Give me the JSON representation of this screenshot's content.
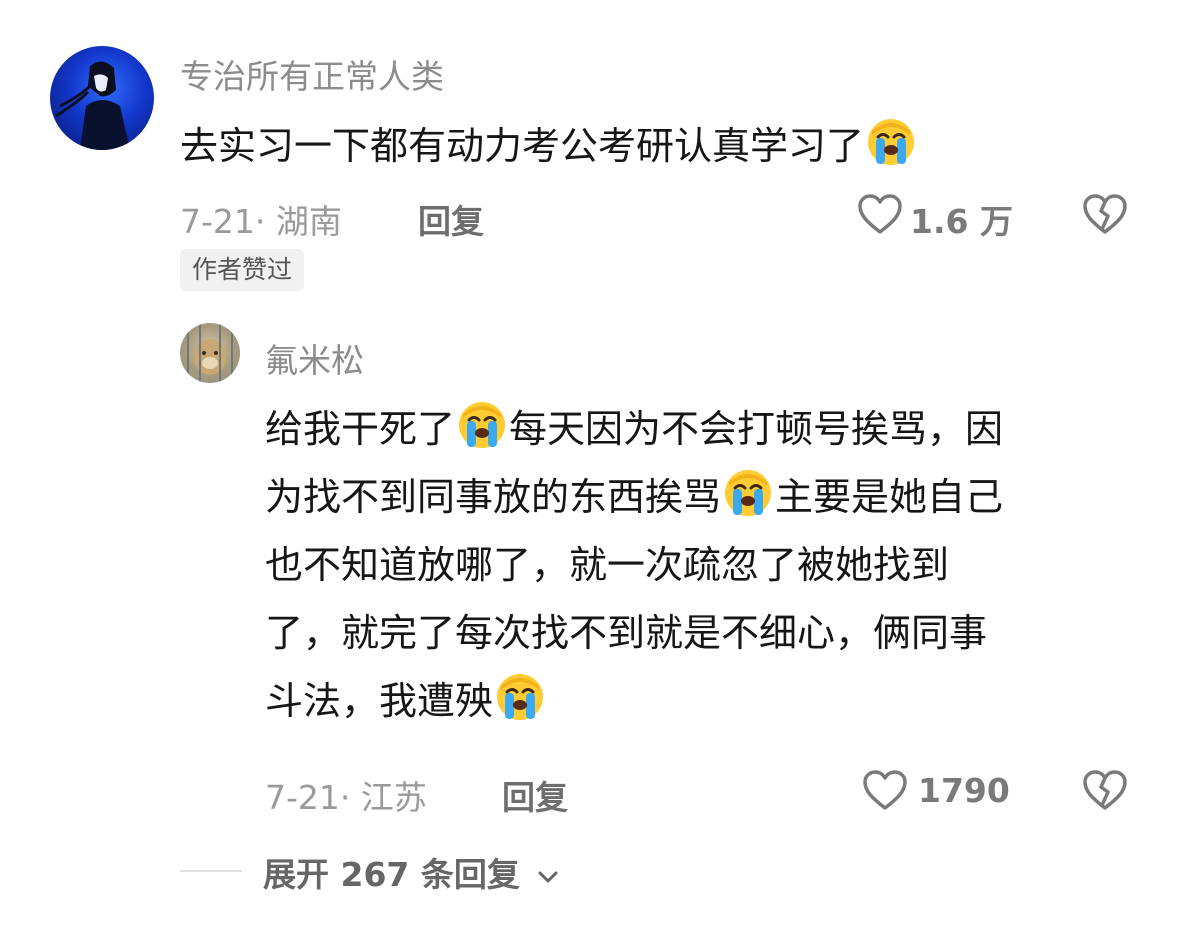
{
  "comments": [
    {
      "username": "专治所有正常人类",
      "text_parts": [
        "去实习一下都有动力考公考研认真学习了"
      ],
      "date_location": "7-21· 湖南",
      "reply_label": "回复",
      "like_count": "1.6 万",
      "badge": "作者赞过"
    },
    {
      "username": "氟米松",
      "lines": [
        [
          "给我干死了",
          "每天因为不会打顿号挨骂，因"
        ],
        [
          "为找不到同事放的东西挨骂",
          "主要是她自己"
        ],
        [
          "也不知道放哪了，就一次疏忽了被她找到"
        ],
        [
          "了，就完了每次找不到就是不细心，俩同事"
        ],
        [
          "斗法，我遭殃"
        ]
      ],
      "date_location": "7-21· 江苏",
      "reply_label": "回复",
      "like_count": "1790"
    }
  ],
  "expand_label": "展开 267 条回复",
  "icons": {
    "like": "heart-outline-icon",
    "dislike": "broken-heart-icon",
    "emoji": "crying-face-emoji",
    "expand": "chevron-down-icon"
  }
}
